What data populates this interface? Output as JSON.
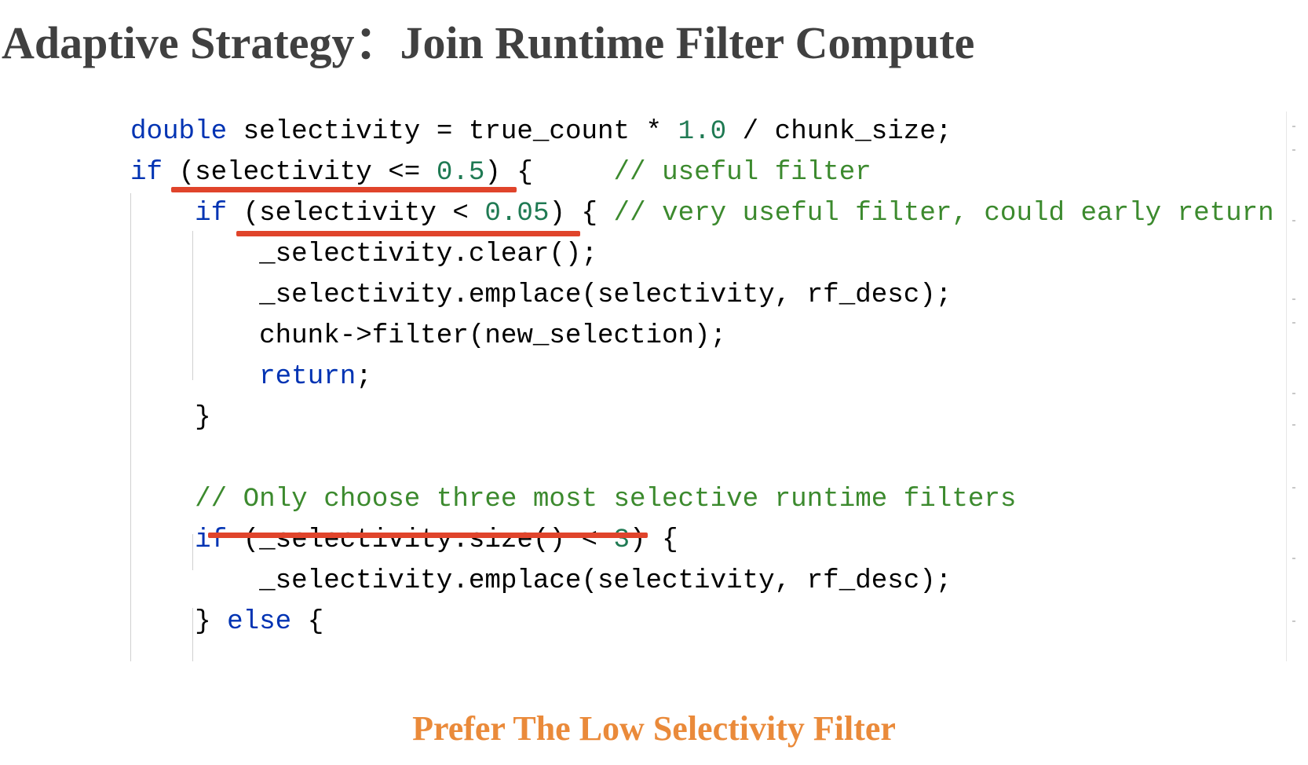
{
  "title": "Adaptive Strategy：Join Runtime Filter Compute",
  "caption": "Prefer The Low Selectivity Filter",
  "colors": {
    "title": "#404040",
    "keyword": "#0033b3",
    "number": "#1f7a53",
    "comment": "#3c8a2e",
    "underline": "#e0442b",
    "caption": "#ea8a3a"
  },
  "code": {
    "lines": [
      [
        {
          "t": "double",
          "c": "kw"
        },
        {
          "t": " selectivity = true_count * "
        },
        {
          "t": "1.0",
          "c": "num"
        },
        {
          "t": " / chunk_size;"
        }
      ],
      [
        {
          "t": "if",
          "c": "kw"
        },
        {
          "t": " (selectivity <= "
        },
        {
          "t": "0.5",
          "c": "num"
        },
        {
          "t": ") {     "
        },
        {
          "t": "// useful filter",
          "c": "com"
        }
      ],
      [
        {
          "t": "    "
        },
        {
          "t": "if",
          "c": "kw"
        },
        {
          "t": " (selectivity < "
        },
        {
          "t": "0.05",
          "c": "num"
        },
        {
          "t": ") { "
        },
        {
          "t": "// very useful filter, could early return",
          "c": "com"
        }
      ],
      [
        {
          "t": "        _selectivity.clear();"
        }
      ],
      [
        {
          "t": "        _selectivity.emplace(selectivity, rf_desc);"
        }
      ],
      [
        {
          "t": "        chunk->filter(new_selection);"
        }
      ],
      [
        {
          "t": "        "
        },
        {
          "t": "return",
          "c": "kw"
        },
        {
          "t": ";"
        }
      ],
      [
        {
          "t": "    }"
        }
      ],
      [],
      [
        {
          "t": "    "
        },
        {
          "t": "// Only choose three most selective runtime filters",
          "c": "com"
        }
      ],
      [
        {
          "t": "    "
        },
        {
          "t": "if",
          "c": "kw"
        },
        {
          "t": " (_selectivity.size() < "
        },
        {
          "t": "3",
          "c": "num"
        },
        {
          "t": ") {"
        }
      ],
      [
        {
          "t": "        _selectivity.emplace(selectivity, rf_desc);"
        }
      ],
      [
        {
          "t": "    } "
        },
        {
          "t": "else",
          "c": "kw"
        },
        {
          "t": " {"
        }
      ]
    ]
  }
}
